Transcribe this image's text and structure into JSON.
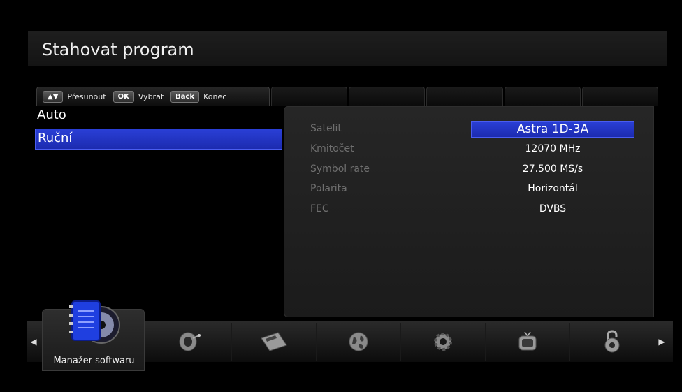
{
  "header": {
    "title": "Stahovat program"
  },
  "help": {
    "move_label": "Přesunout",
    "ok_key": "OK",
    "select_label": "Vybrat",
    "back_key": "Back",
    "exit_label": "Konec"
  },
  "modes": [
    {
      "label": "Auto",
      "selected": false
    },
    {
      "label": "Ruční",
      "selected": true
    }
  ],
  "params": [
    {
      "label": "Satelit",
      "value": "Astra 1D-3A"
    },
    {
      "label": "Kmitočet",
      "value": "12070 MHz"
    },
    {
      "label": "Symbol rate",
      "value": "27.500 MS/s"
    },
    {
      "label": "Polarita",
      "value": "Horizontál"
    },
    {
      "label": "FEC",
      "value": "DVBS"
    }
  ],
  "bottom_menu": {
    "active_label": "Manažer softwaru",
    "icons": [
      "software-manager-icon",
      "satellite-dish-icon",
      "card-icon",
      "globe-icon",
      "gear-icon",
      "tv-icon",
      "padlock-icon"
    ]
  },
  "colors": {
    "accent": "#2233cc",
    "background": "#000000"
  }
}
